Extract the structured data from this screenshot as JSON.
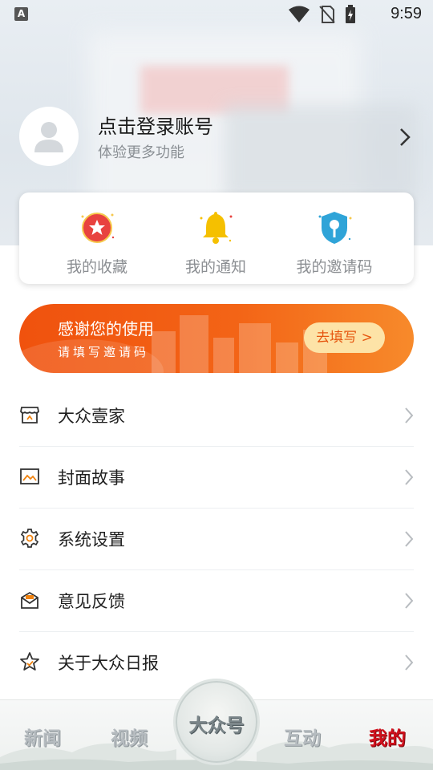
{
  "status_bar": {
    "time": "9:59",
    "notif_letter": "A"
  },
  "profile": {
    "login_title": "点击登录账号",
    "login_subtitle": "体验更多功能"
  },
  "quick_actions": [
    {
      "label": "我的收藏",
      "icon": "star-badge-icon"
    },
    {
      "label": "我的通知",
      "icon": "bell-icon"
    },
    {
      "label": "我的邀请码",
      "icon": "key-shield-icon"
    }
  ],
  "banner": {
    "title": "感谢您的使用",
    "subtitle": "请填写邀请码",
    "button": "去填写 >"
  },
  "menu": [
    {
      "label": "大众壹家",
      "icon": "store-icon"
    },
    {
      "label": "封面故事",
      "icon": "picture-icon"
    },
    {
      "label": "系统设置",
      "icon": "gear-icon"
    },
    {
      "label": "意见反馈",
      "icon": "mail-icon"
    },
    {
      "label": "关于大众日报",
      "icon": "star-outline-icon"
    }
  ],
  "tabs": {
    "news": "新闻",
    "video": "视频",
    "center": "大众号",
    "interact": "互动",
    "mine": "我的"
  },
  "colors": {
    "accent": "#f0520e",
    "active_tab": "#d1101c",
    "gold": "#f5c000"
  }
}
